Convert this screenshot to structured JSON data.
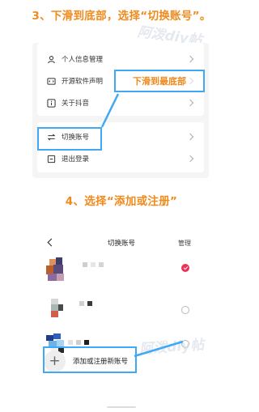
{
  "steps": {
    "step3_title": "3、下滑到底部，选择“切换账号”。",
    "step4_title": "4、选择“添加或注册”"
  },
  "watermark_text": "阿泼diy帖",
  "settings": {
    "items": [
      {
        "label": "个人信息管理",
        "icon": "person-icon"
      },
      {
        "label": "开源软件声明",
        "icon": "code-icon"
      },
      {
        "label": "关于抖音",
        "icon": "info-icon"
      },
      {
        "label": "切换账号",
        "icon": "switch-arrows-icon"
      },
      {
        "label": "退出登录",
        "icon": "logout-icon"
      }
    ]
  },
  "callout": {
    "text": "下滑到最底部"
  },
  "switch_screen": {
    "title": "切换账号",
    "manage_label": "管理",
    "add_label": "添加或注册新账号",
    "accounts": [
      {
        "selected": true
      },
      {
        "selected": false
      },
      {
        "selected": false
      }
    ]
  },
  "colors": {
    "accent_orange": "#f08a1c",
    "highlight_blue": "#3fa9f5",
    "selected_red": "#ef2f55"
  }
}
